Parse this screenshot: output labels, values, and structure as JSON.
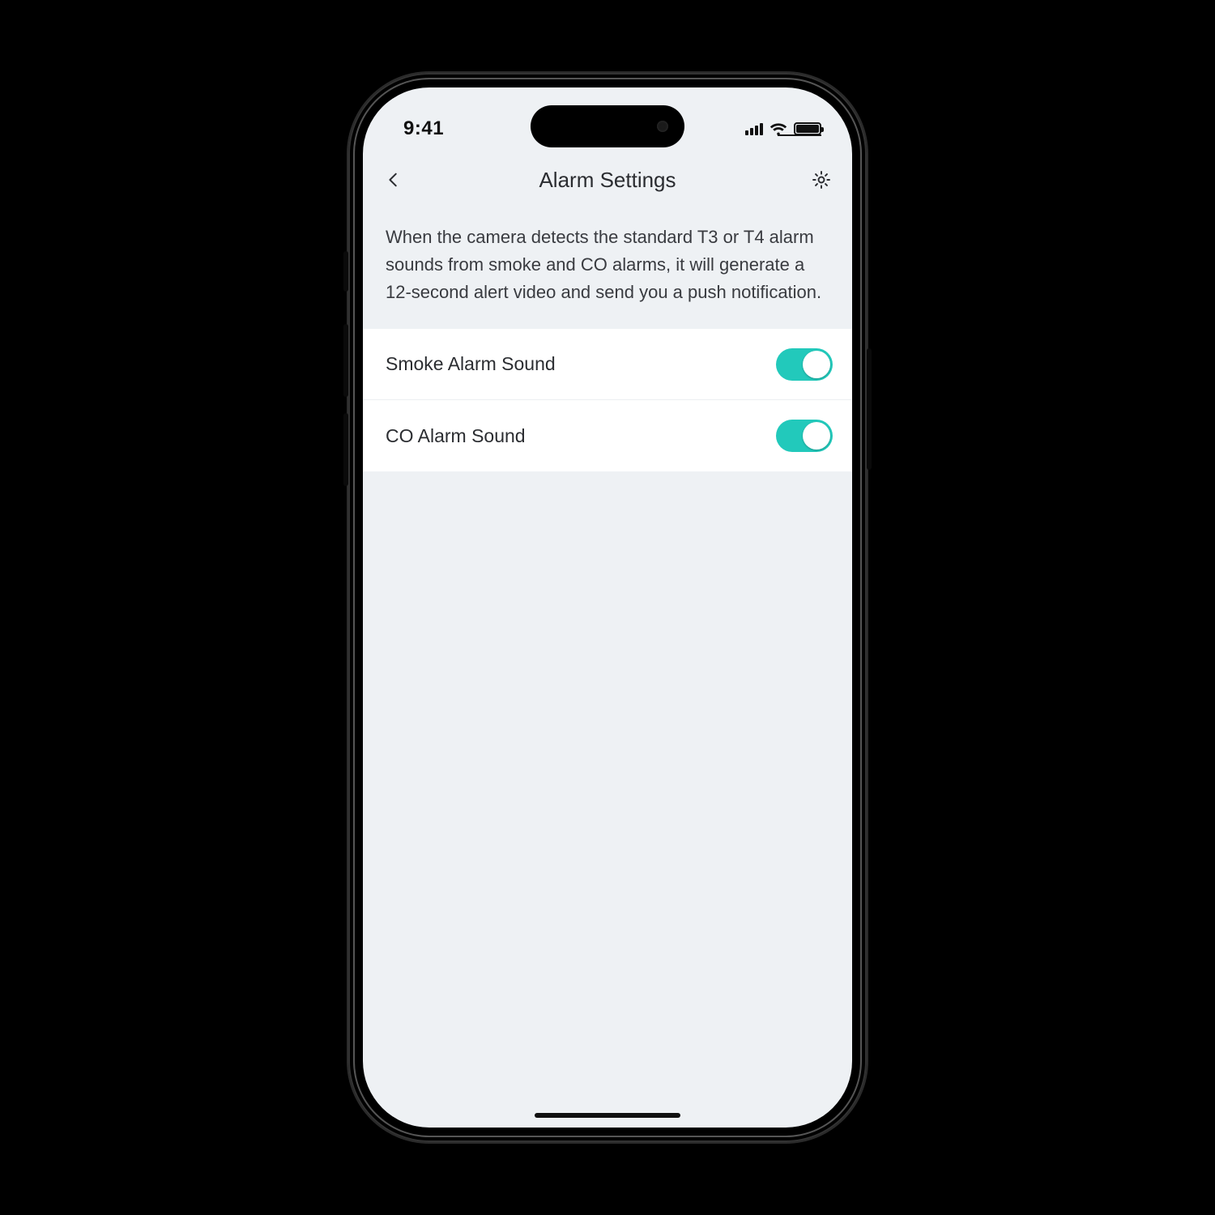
{
  "statusbar": {
    "time": "9:41"
  },
  "navbar": {
    "title": "Alarm Settings"
  },
  "description": "When the camera detects the standard T3 or T4 alarm sounds from smoke and CO alarms, it will generate a 12-second alert video and send you a push notification.",
  "settings": [
    {
      "label": "Smoke Alarm Sound",
      "on": true
    },
    {
      "label": "CO Alarm Sound",
      "on": true
    }
  ],
  "colors": {
    "accent": "#22c9bb",
    "screen_bg": "#eef1f4",
    "text": "#2b2d31"
  }
}
